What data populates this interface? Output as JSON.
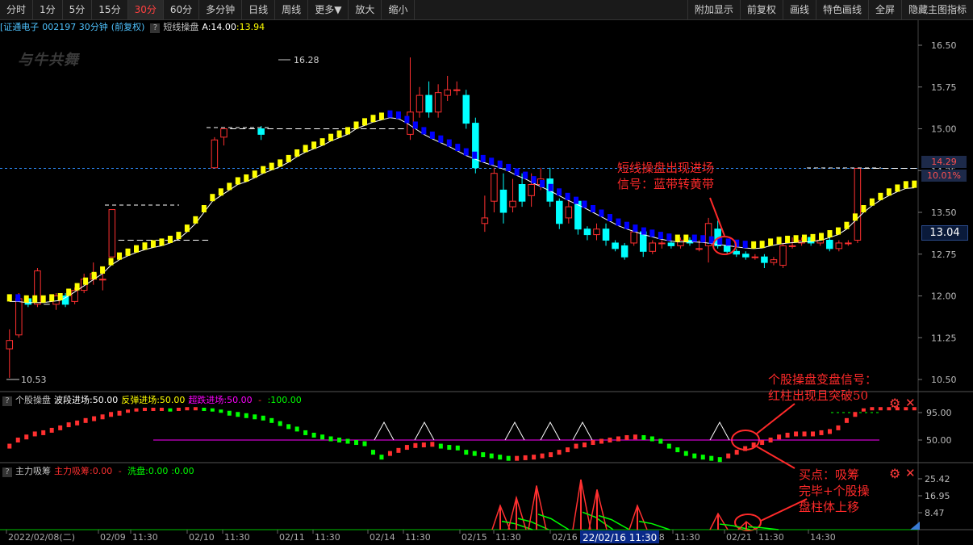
{
  "toolbar": {
    "left": [
      "分时",
      "1分",
      "5分",
      "15分",
      "30分",
      "60分",
      "多分钟",
      "日线",
      "周线",
      "更多▼",
      "放大",
      "缩小"
    ],
    "active_index": 4,
    "right": [
      "附加显示",
      "前复权",
      "画线",
      "特色画线",
      "全屏",
      "隐藏主图指标"
    ]
  },
  "main_title": {
    "stock": "[证通电子",
    "code_period": "002197 30分钟",
    "adj": "(前复权)",
    "indicator": "短线操盘",
    "a_label": "A:14.00",
    "a_value": ":13.94"
  },
  "logo_text": "与牛共舞",
  "price_axis": [
    "16.50",
    "15.75",
    "15.00",
    "14.25",
    "13.50",
    "12.75",
    "12.00",
    "11.25",
    "10.50"
  ],
  "current_price": "13.04",
  "last_price_tag": "14.29",
  "last_pct_tag": "10.01%",
  "high_label": "16.28",
  "low_label": "10.53",
  "annotations": {
    "entry_signal": [
      "短线操盘出现进场",
      "信号：蓝带转黄带"
    ],
    "stock_signal": [
      "个股操盘变盘信号：",
      "红柱出现且突破50"
    ],
    "buy_point": [
      "买点：吸筹",
      "完毕+个股操",
      "盘柱体上移"
    ]
  },
  "panel2": {
    "name": "个股操盘",
    "wave": "波段进场:50.00",
    "rebound": "反弹进场:50.00",
    "oversold": "超跌进场:50.00",
    "dash": " - ",
    "value": ":100.00",
    "axis": [
      "95.00",
      "50.00"
    ]
  },
  "panel3": {
    "name": "主力吸筹",
    "accum": "主力吸筹:0.00",
    "dash": " - ",
    "wash": "洗盘:0.00",
    "value": ":0.00",
    "axis": [
      "25.42",
      "16.95",
      "8.47"
    ]
  },
  "time_axis": [
    "2022/02/08(二)",
    "02/09",
    "11:30",
    "02/10",
    "11:30",
    "02/11",
    "11:30",
    "02/14",
    "11:30",
    "02/15",
    "11:30",
    "02/16",
    "11:30",
    "02/18",
    "11:30",
    "02/21",
    "11:30",
    "14:30"
  ],
  "crosshair_time": "22/02/16 11:30",
  "colors": {
    "up": "#ff3030",
    "down": "#00ffff",
    "ma_yellow": "#ffff00",
    "ma_blue": "#0000ff",
    "annotation": "#ff2a2a",
    "magenta": "#ff00ff"
  },
  "chart_data": {
    "type": "candlestick",
    "ohlc": [
      [
        11.05,
        11.2,
        10.53,
        11.4
      ],
      [
        11.3,
        11.95,
        11.25,
        12.05
      ],
      [
        11.95,
        11.85,
        11.8,
        12.0
      ],
      [
        11.85,
        12.45,
        11.8,
        12.5
      ],
      [
        11.85,
        11.85,
        11.85,
        11.85
      ],
      [
        11.85,
        12.0,
        11.75,
        12.05
      ],
      [
        12.0,
        11.85,
        11.8,
        12.05
      ],
      [
        11.9,
        12.1,
        11.85,
        12.15
      ],
      [
        12.1,
        12.3,
        12.05,
        12.4
      ],
      [
        12.3,
        12.4,
        12.2,
        12.6
      ],
      [
        12.3,
        12.3,
        12.1,
        12.5
      ],
      [
        12.7,
        13.55,
        12.7,
        13.55
      ],
      [
        13.0,
        13.0,
        13.0,
        13.0
      ],
      [
        13.0,
        13.0,
        13.0,
        13.0
      ],
      [
        13.0,
        13.0,
        13.0,
        13.0
      ],
      [
        13.0,
        13.0,
        13.0,
        13.0
      ],
      [
        13.0,
        13.0,
        13.0,
        13.0
      ],
      [
        13.0,
        13.0,
        13.0,
        13.0
      ],
      [
        13.0,
        13.0,
        13.0,
        13.0
      ],
      [
        13.0,
        13.0,
        13.0,
        13.0
      ],
      [
        13.0,
        13.0,
        13.0,
        13.0
      ],
      [
        13.0,
        13.0,
        13.0,
        13.0
      ],
      [
        14.3,
        14.8,
        14.3,
        14.85
      ],
      [
        14.85,
        15.0,
        14.7,
        15.0
      ],
      [
        15.0,
        15.0,
        15.0,
        15.0
      ],
      [
        15.0,
        15.0,
        15.0,
        15.0
      ],
      [
        15.0,
        15.0,
        15.0,
        15.0
      ],
      [
        15.0,
        14.9,
        14.8,
        15.05
      ],
      [
        15.0,
        15.0,
        15.0,
        15.0
      ],
      [
        15.0,
        15.0,
        15.0,
        15.0
      ],
      [
        15.0,
        15.0,
        15.0,
        15.0
      ],
      [
        15.0,
        15.0,
        15.0,
        15.0
      ],
      [
        15.0,
        15.0,
        15.0,
        15.0
      ],
      [
        15.0,
        15.0,
        15.0,
        15.0
      ],
      [
        15.0,
        15.0,
        15.0,
        15.0
      ],
      [
        15.0,
        15.0,
        15.0,
        15.0
      ],
      [
        15.0,
        15.0,
        15.0,
        15.0
      ],
      [
        15.0,
        15.0,
        15.0,
        15.0
      ],
      [
        15.0,
        15.0,
        15.0,
        15.0
      ],
      [
        15.0,
        15.0,
        15.0,
        15.0
      ],
      [
        15.0,
        15.0,
        15.0,
        15.0
      ],
      [
        15.0,
        15.0,
        15.0,
        15.0
      ],
      [
        15.0,
        15.0,
        15.0,
        15.0
      ],
      [
        14.9,
        15.3,
        14.8,
        16.28
      ],
      [
        15.3,
        15.6,
        15.2,
        15.75
      ],
      [
        15.6,
        15.3,
        15.2,
        15.85
      ],
      [
        15.3,
        15.65,
        15.2,
        15.8
      ],
      [
        15.6,
        15.7,
        15.5,
        15.95
      ],
      [
        15.7,
        15.7,
        15.6,
        15.85
      ],
      [
        15.6,
        15.1,
        15.0,
        15.7
      ],
      [
        15.1,
        14.3,
        14.2,
        15.2
      ],
      [
        13.3,
        13.4,
        13.15,
        13.8
      ],
      [
        13.7,
        14.2,
        13.5,
        14.3
      ],
      [
        13.9,
        13.5,
        13.3,
        14.2
      ],
      [
        13.6,
        13.7,
        13.5,
        14.1
      ],
      [
        14.0,
        13.7,
        13.6,
        14.2
      ],
      [
        13.8,
        14.0,
        13.6,
        14.2
      ],
      [
        14.0,
        14.1,
        13.9,
        14.3
      ],
      [
        14.1,
        13.7,
        13.6,
        14.3
      ],
      [
        13.7,
        13.3,
        13.2,
        13.75
      ],
      [
        13.4,
        13.6,
        13.3,
        13.8
      ],
      [
        13.7,
        13.2,
        13.1,
        13.75
      ],
      [
        13.2,
        13.1,
        13.0,
        13.25
      ],
      [
        13.1,
        13.2,
        13.0,
        13.3
      ],
      [
        13.2,
        13.0,
        12.9,
        13.3
      ],
      [
        12.95,
        12.85,
        12.8,
        13.0
      ],
      [
        12.9,
        12.7,
        12.65,
        12.95
      ],
      [
        12.95,
        13.15,
        12.9,
        13.2
      ],
      [
        13.15,
        12.8,
        12.7,
        13.2
      ],
      [
        12.8,
        12.95,
        12.75,
        13.0
      ],
      [
        12.95,
        12.95,
        12.85,
        13.0
      ],
      [
        12.95,
        12.9,
        12.85,
        13.0
      ],
      [
        12.9,
        13.0,
        12.85,
        13.05
      ],
      [
        13.0,
        12.95,
        12.9,
        13.05
      ],
      [
        12.85,
        12.85,
        12.8,
        13.0
      ],
      [
        12.9,
        13.3,
        12.6,
        13.4
      ],
      [
        13.2,
        12.9,
        12.85,
        13.35
      ],
      [
        12.9,
        12.8,
        12.75,
        12.95
      ],
      [
        12.8,
        12.75,
        12.7,
        12.85
      ],
      [
        12.75,
        12.7,
        12.65,
        12.8
      ],
      [
        12.7,
        12.7,
        12.65,
        12.75
      ],
      [
        12.7,
        12.6,
        12.5,
        12.75
      ],
      [
        12.6,
        12.65,
        12.55,
        12.7
      ],
      [
        12.55,
        12.9,
        12.5,
        12.95
      ],
      [
        12.9,
        12.9,
        12.85,
        13.05
      ],
      [
        12.95,
        13.0,
        12.9,
        13.05
      ],
      [
        13.05,
        12.95,
        12.9,
        13.1
      ],
      [
        12.95,
        13.0,
        12.9,
        13.05
      ],
      [
        13.0,
        12.85,
        12.8,
        13.05
      ],
      [
        12.85,
        12.95,
        12.8,
        13.0
      ],
      [
        12.95,
        12.95,
        12.9,
        13.0
      ],
      [
        13.0,
        14.29,
        12.95,
        14.29
      ],
      [
        14.29,
        14.29,
        14.29,
        14.29
      ],
      [
        14.29,
        14.29,
        14.29,
        14.29
      ],
      [
        14.29,
        14.29,
        14.29,
        14.29
      ],
      [
        14.29,
        14.29,
        14.29,
        14.29
      ],
      [
        14.29,
        14.29,
        14.29,
        14.29
      ],
      [
        14.29,
        14.29,
        14.29,
        14.29
      ]
    ],
    "ma": [
      11.9,
      11.9,
      11.88,
      11.88,
      11.88,
      11.9,
      11.92,
      12.0,
      12.1,
      12.2,
      12.3,
      12.4,
      12.55,
      12.65,
      12.72,
      12.78,
      12.83,
      12.87,
      12.9,
      12.95,
      13.02,
      13.15,
      13.3,
      13.5,
      13.7,
      13.8,
      13.9,
      14.0,
      14.05,
      14.12,
      14.2,
      14.26,
      14.32,
      14.4,
      14.5,
      14.58,
      14.64,
      14.7,
      14.78,
      14.84,
      14.9,
      15.0,
      15.06,
      15.12,
      15.16,
      15.2,
      15.18,
      15.1,
      15.0,
      14.9,
      14.82,
      14.75,
      14.68,
      14.6,
      14.52,
      14.46,
      14.4,
      14.35,
      14.3,
      14.24,
      14.16,
      14.1,
      14.02,
      13.95,
      13.88,
      13.8,
      13.72,
      13.65,
      13.58,
      13.5,
      13.42,
      13.34,
      13.26,
      13.2,
      13.15,
      13.1,
      13.06,
      13.02,
      12.99,
      12.97,
      12.97,
      12.97,
      12.96,
      12.94,
      12.92,
      12.9,
      12.88,
      12.86,
      12.85,
      12.86,
      12.9,
      12.93,
      12.95,
      12.96,
      12.97,
      12.98,
      13.0,
      13.05,
      13.1,
      13.2,
      13.35,
      13.5,
      13.62,
      13.72,
      13.8,
      13.87,
      13.93,
      13.94
    ],
    "oscillator": [
      40,
      50,
      55,
      60,
      62,
      66,
      70,
      75,
      78,
      82,
      85,
      88,
      92,
      94,
      96,
      98,
      99,
      99,
      99,
      98,
      99,
      100,
      100,
      99,
      98,
      96,
      94,
      92,
      90,
      88,
      86,
      82,
      77,
      72,
      68,
      62,
      58,
      55,
      52,
      50,
      48,
      46,
      44,
      30,
      22,
      28,
      33,
      38,
      41,
      42,
      43,
      40,
      38,
      37,
      30,
      28,
      26,
      24,
      22,
      20,
      20,
      21,
      22,
      24,
      26,
      30,
      34,
      40,
      42,
      46,
      48,
      50,
      52,
      54,
      55,
      54,
      52,
      48,
      40,
      34,
      28,
      24,
      22,
      20,
      18,
      24,
      30,
      36,
      42,
      46,
      50,
      55,
      58,
      60,
      60,
      60,
      62,
      64,
      70,
      82,
      92,
      98,
      100,
      100,
      100,
      100,
      100,
      100
    ]
  }
}
